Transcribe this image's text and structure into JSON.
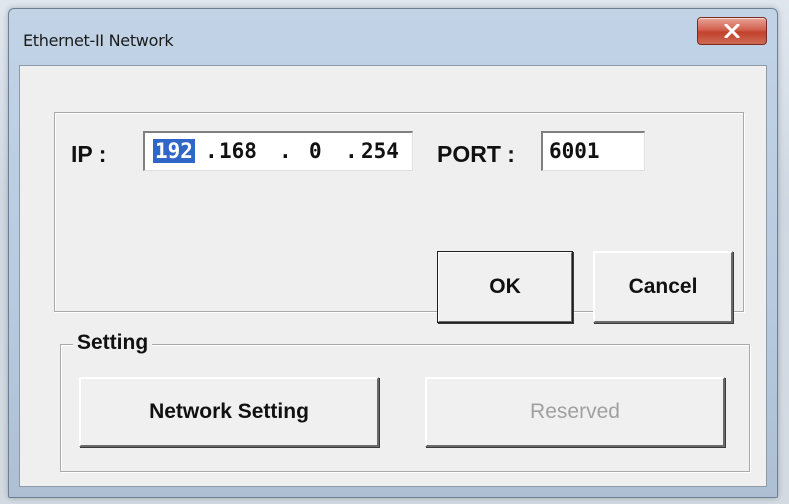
{
  "window": {
    "title": "Ethernet-II Network",
    "close_glyph": "x"
  },
  "connection": {
    "ip_label": "IP :",
    "ip_octets": [
      "192",
      "168",
      "0",
      "254"
    ],
    "ip_dot": ".",
    "port_label": "PORT :",
    "port_value": "6001",
    "ok_label": "OK",
    "cancel_label": "Cancel"
  },
  "setting": {
    "legend": "Setting",
    "network_setting_label": "Network Setting",
    "reserved_label": "Reserved"
  },
  "colors": {
    "selection": "#3166c9",
    "close_button": "#c1422d",
    "disabled_text": "#a0a0a0"
  }
}
